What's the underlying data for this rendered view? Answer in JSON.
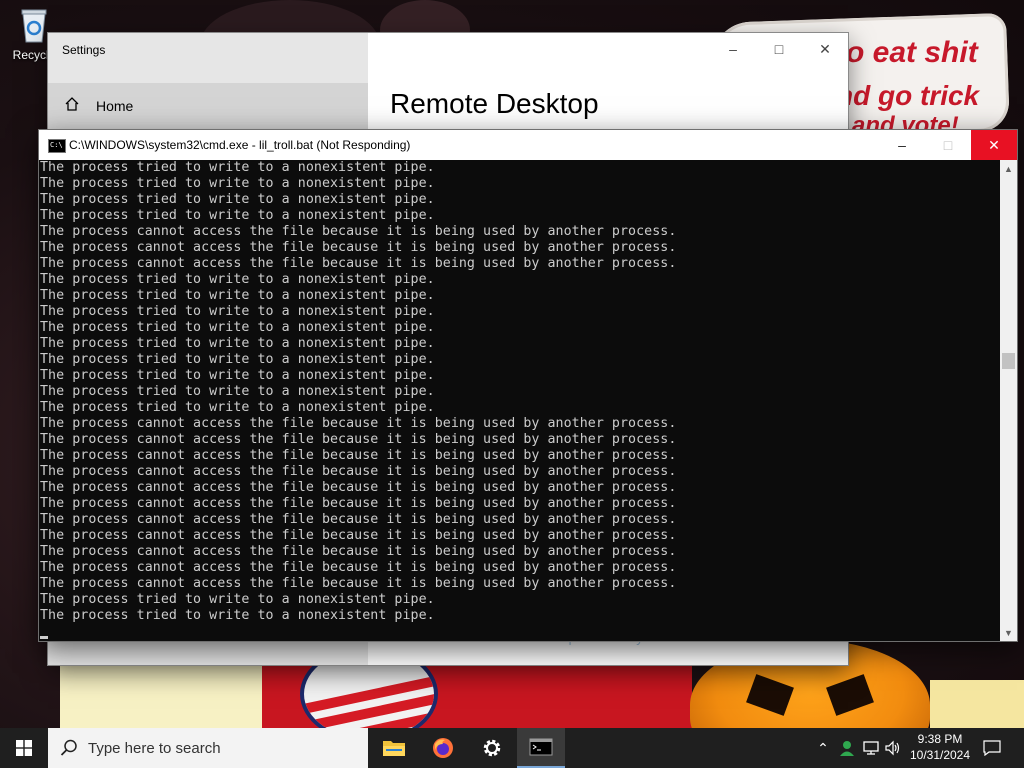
{
  "desktop": {
    "recycle_bin_label": "Recycle",
    "wallpaper_text": [
      "o eat shit",
      "nd go trick",
      "and vote!"
    ]
  },
  "settings": {
    "window_title": "Settings",
    "home_label": "Home",
    "heading": "Remote Desktop",
    "partial_hint": "Don't have a Remote Desktop client on your remote device?"
  },
  "cmd": {
    "title": "C:\\WINDOWS\\system32\\cmd.exe - lil_troll.bat (Not Responding)",
    "lines": [
      "The process tried to write to a nonexistent pipe.",
      "The process tried to write to a nonexistent pipe.",
      "The process tried to write to a nonexistent pipe.",
      "The process tried to write to a nonexistent pipe.",
      "The process cannot access the file because it is being used by another process.",
      "The process cannot access the file because it is being used by another process.",
      "The process cannot access the file because it is being used by another process.",
      "The process tried to write to a nonexistent pipe.",
      "The process tried to write to a nonexistent pipe.",
      "The process tried to write to a nonexistent pipe.",
      "The process tried to write to a nonexistent pipe.",
      "The process tried to write to a nonexistent pipe.",
      "The process tried to write to a nonexistent pipe.",
      "The process tried to write to a nonexistent pipe.",
      "The process tried to write to a nonexistent pipe.",
      "The process tried to write to a nonexistent pipe.",
      "The process cannot access the file because it is being used by another process.",
      "The process cannot access the file because it is being used by another process.",
      "The process cannot access the file because it is being used by another process.",
      "The process cannot access the file because it is being used by another process.",
      "The process cannot access the file because it is being used by another process.",
      "The process cannot access the file because it is being used by another process.",
      "The process cannot access the file because it is being used by another process.",
      "The process cannot access the file because it is being used by another process.",
      "The process cannot access the file because it is being used by another process.",
      "The process cannot access the file because it is being used by another process.",
      "The process cannot access the file because it is being used by another process.",
      "The process tried to write to a nonexistent pipe.",
      "The process tried to write to a nonexistent pipe."
    ]
  },
  "taskbar": {
    "search_placeholder": "Type here to search",
    "apps": [
      "file-explorer-icon",
      "firefox-icon",
      "settings-icon",
      "terminal-icon"
    ],
    "clock_time": "9:38 PM",
    "clock_date": "10/31/2024"
  },
  "colors": {
    "console_bg": "#0c0c0c",
    "console_text": "#cccccc",
    "close_red": "#e81123",
    "taskbar_bg": "#1f1f1f"
  }
}
